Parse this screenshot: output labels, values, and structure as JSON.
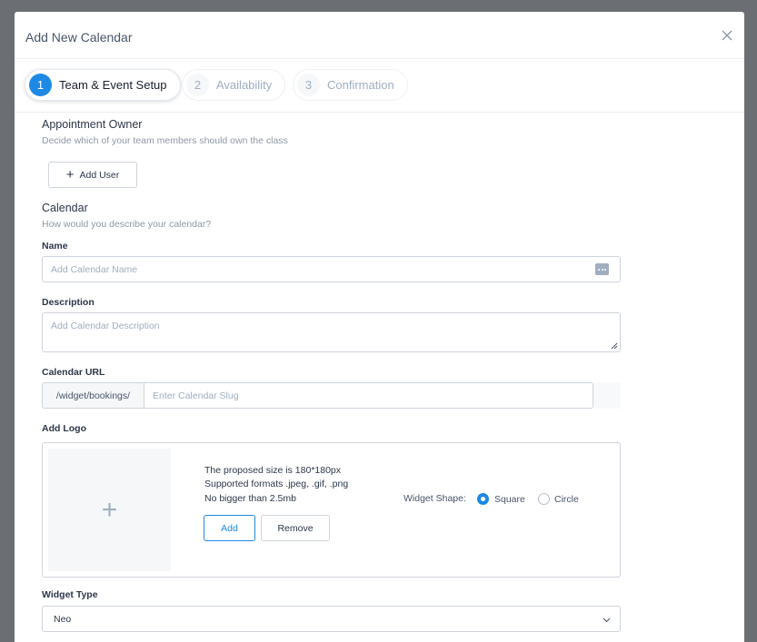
{
  "modal": {
    "title": "Add New Calendar",
    "close_icon": "close-icon"
  },
  "steps": [
    {
      "number": "1",
      "label": "Team & Event Setup",
      "active": true
    },
    {
      "number": "2",
      "label": "Availability",
      "active": false
    },
    {
      "number": "3",
      "label": "Confirmation",
      "active": false
    }
  ],
  "owner": {
    "title": "Appointment Owner",
    "subtitle": "Decide which of your team members should own the class",
    "add_user_label": "Add User",
    "add_user_icon": "plus-icon"
  },
  "calendar": {
    "title": "Calendar",
    "subtitle": "How would you describe your calendar?",
    "name_label": "Name",
    "name_placeholder": "Add Calendar Name",
    "name_value": "",
    "description_label": "Description",
    "description_placeholder": "Add Calendar Description",
    "description_value": "",
    "url_label": "Calendar URL",
    "url_prefix": "/widget/bookings/",
    "slug_placeholder": "Enter Calendar Slug",
    "slug_value": ""
  },
  "logo": {
    "label": "Add Logo",
    "note_size": "The proposed size is 180*180px",
    "note_formats": "Supported formats .jpeg, .gif, .png",
    "note_limit": "No bigger than 2.5mb",
    "add_label": "Add",
    "remove_label": "Remove",
    "shape_label": "Widget Shape:",
    "shape_options": [
      "Square",
      "Circle"
    ],
    "shape_selected": "Square"
  },
  "widget_type": {
    "label": "Widget Type",
    "selected": "Neo"
  },
  "colors": {
    "accent": "#1e88e5",
    "border": "#cfd5dd",
    "backdrop": "#6b6e72"
  }
}
